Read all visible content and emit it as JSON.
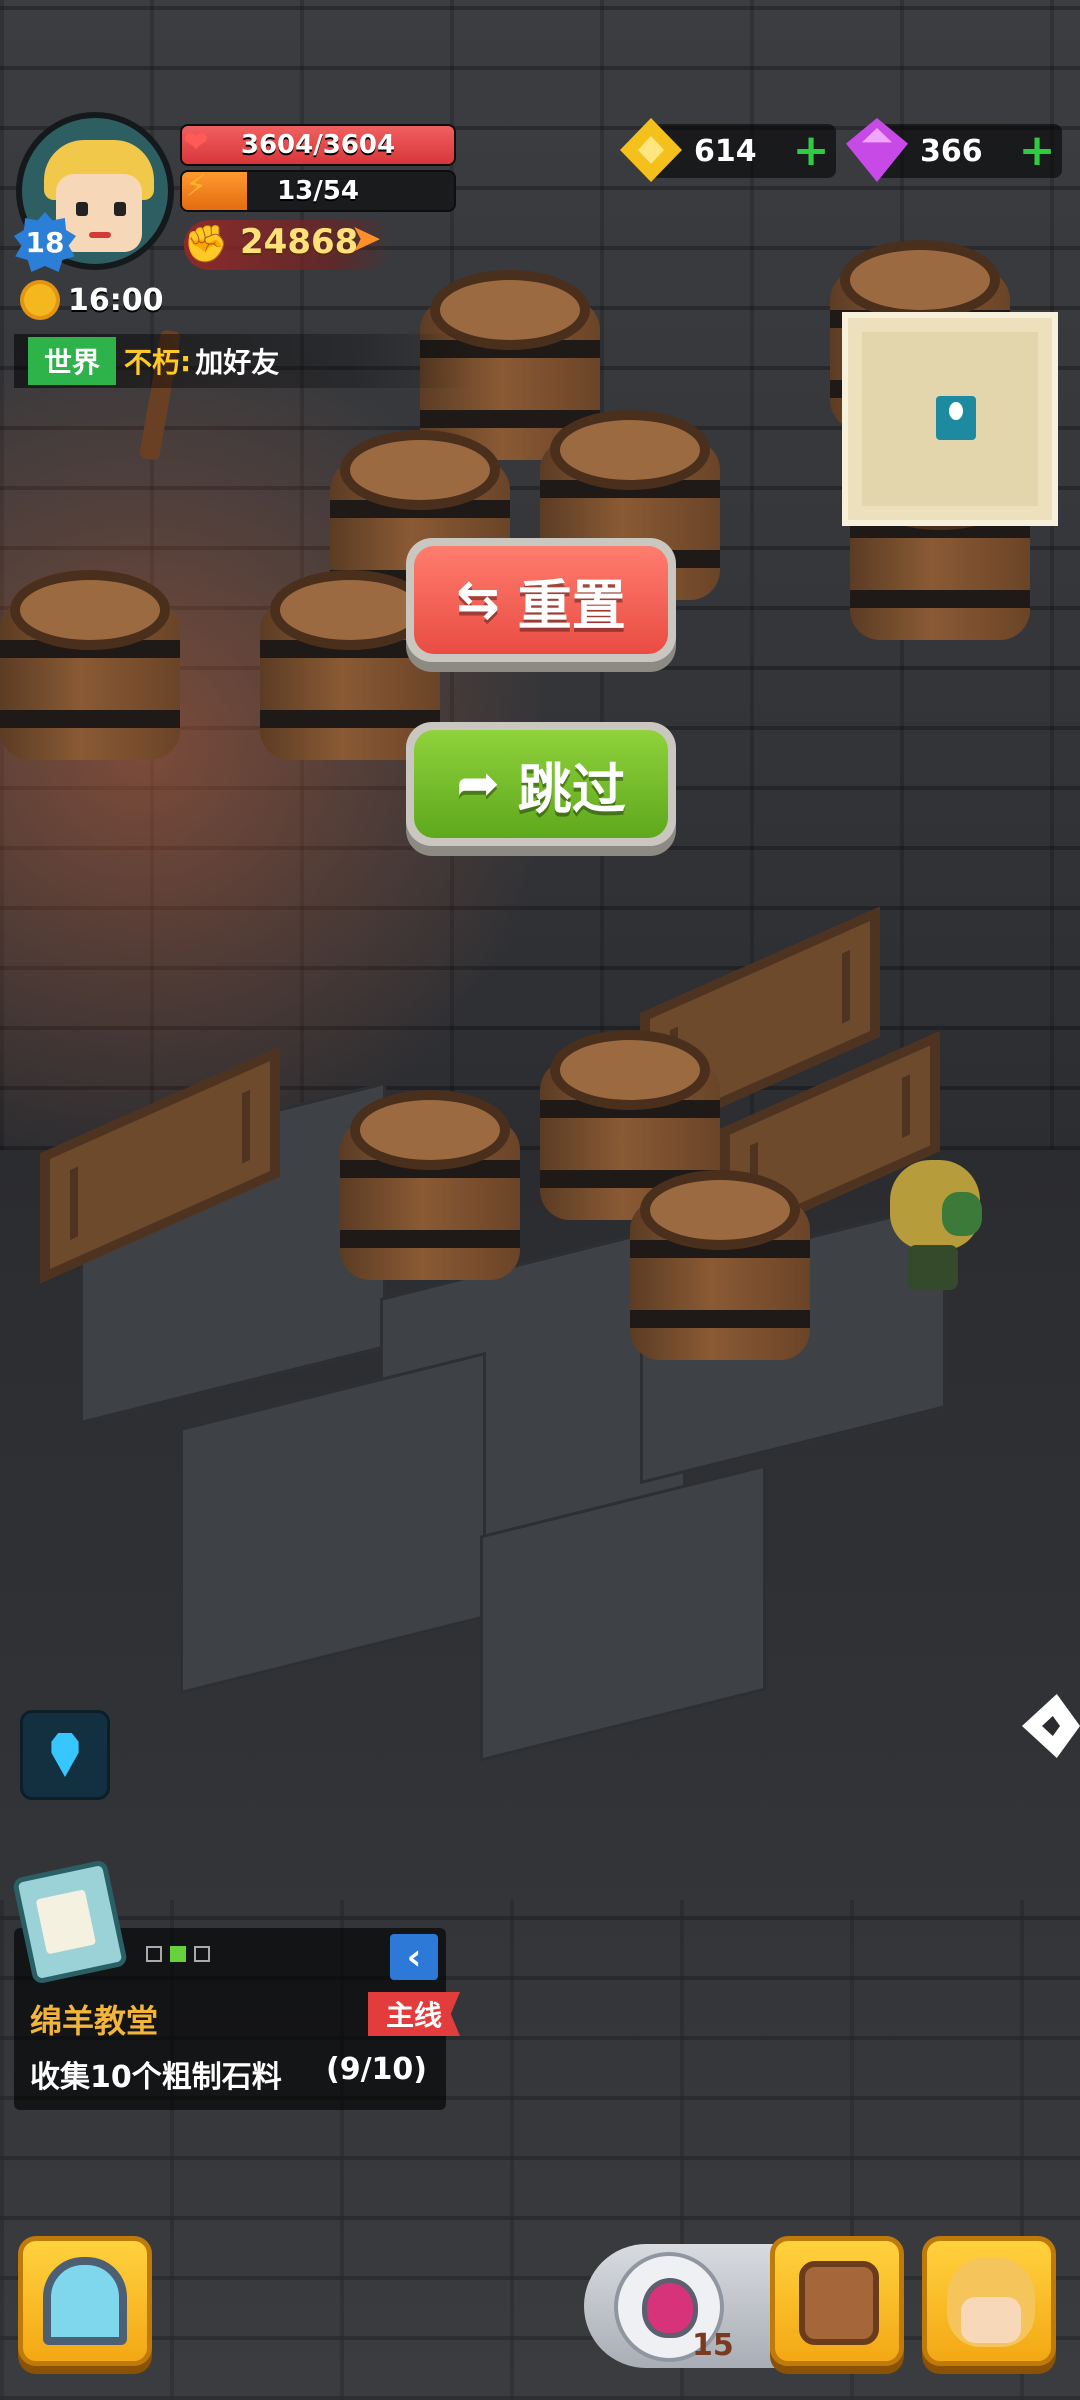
{
  "player": {
    "level": "18",
    "hp": "3604/3604",
    "hp_fraction": 1.0,
    "energy": "13/54",
    "energy_fraction": 0.24,
    "power": "24868",
    "time": "16:00"
  },
  "chat": {
    "channel": "世界",
    "user": "不朽",
    "colon": ":",
    "message": "加好友"
  },
  "currency": {
    "gold": "614",
    "gems": "366"
  },
  "buttons": {
    "reset": "重置",
    "skip": "跳过"
  },
  "quest": {
    "title": "绵羊教堂",
    "tag": "主线",
    "description": "收集10个粗制石料",
    "progress": "(9/10)",
    "page_dots": 3,
    "active_dot": 1
  },
  "bottom_bar": {
    "potion_count": "15"
  },
  "colors": {
    "hp": "#e23b3f",
    "energy": "#f07a16",
    "reset_button": "#ee5648",
    "skip_button": "#6ab322",
    "quest_title": "#f2b43b",
    "quest_tag": "#e33c3c"
  },
  "icons": [
    "heart-icon",
    "bolt-icon",
    "power-fist-icon",
    "sun-icon",
    "gold-coin-icon",
    "gem-icon",
    "plus-icon",
    "map-pin-icon",
    "reset-icon",
    "skip-arrow-icon",
    "location-icon",
    "quest-clipboard-icon",
    "chevron-left-icon",
    "portal-icon",
    "potion-icon",
    "backpack-icon",
    "hero-icon"
  ]
}
